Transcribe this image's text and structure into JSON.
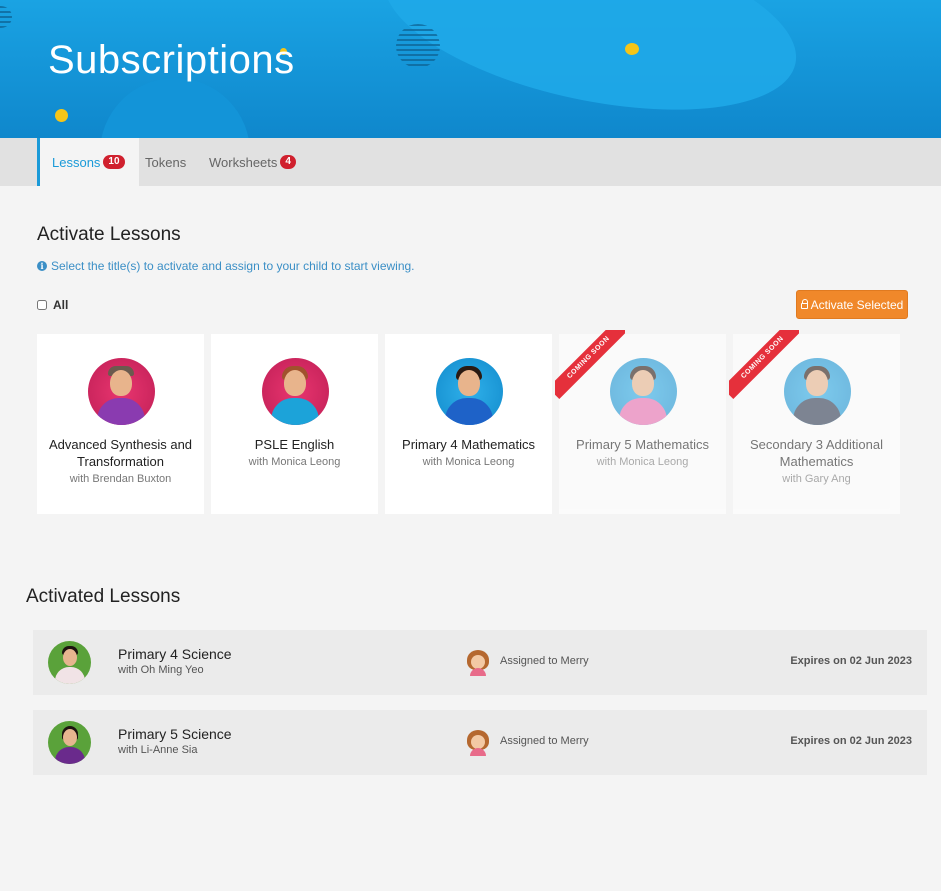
{
  "page": {
    "title": "Subscriptions"
  },
  "tabs": [
    {
      "label": "Lessons",
      "badge": "10"
    },
    {
      "label": "Tokens"
    },
    {
      "label": "Worksheets",
      "badge": "4"
    }
  ],
  "activate": {
    "title": "Activate Lessons",
    "hint": "Select the title(s) to activate and assign to your child to start viewing.",
    "select_all_label": "All",
    "button_label": "Activate Selected",
    "cards": [
      {
        "title": "Advanced Synthesis and Transformation",
        "teacher": "with Brendan Buxton",
        "ribbon": ""
      },
      {
        "title": "PSLE English",
        "teacher": "with Monica Leong",
        "ribbon": ""
      },
      {
        "title": "Primary 4 Mathematics",
        "teacher": "with Monica Leong",
        "ribbon": ""
      },
      {
        "title": "Primary 5 Mathematics",
        "teacher": "with Monica Leong",
        "ribbon": "COMING SOON"
      },
      {
        "title": "Secondary 3 Additional Mathematics",
        "teacher": "with Gary Ang",
        "ribbon": "COMING SOON"
      }
    ]
  },
  "activated": {
    "title": "Activated Lessons",
    "rows": [
      {
        "title": "Primary 4 Science",
        "teacher": "with Oh Ming Yeo",
        "assigned": "Assigned to Merry",
        "expires": "Expires on 02 Jun 2023"
      },
      {
        "title": "Primary 5 Science",
        "teacher": "with Li-Anne Sia",
        "assigned": "Assigned to Merry",
        "expires": "Expires on 02 Jun 2023"
      }
    ]
  },
  "colors": {
    "primary": "#1a9ad8",
    "accent": "#f0882a",
    "badge": "#d0202e",
    "ribbon": "#e5303b"
  }
}
